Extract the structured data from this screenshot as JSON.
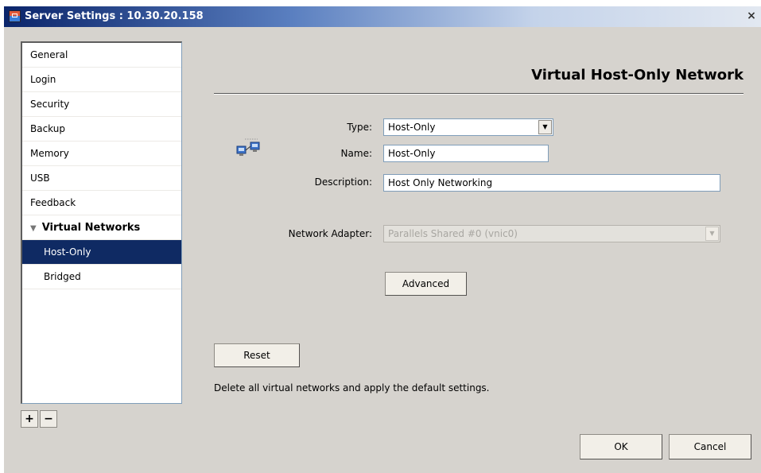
{
  "window": {
    "title": "Server Settings : 10.30.20.158",
    "close_glyph": "×"
  },
  "sidebar": {
    "items": [
      {
        "label": "General"
      },
      {
        "label": "Login"
      },
      {
        "label": "Security"
      },
      {
        "label": "Backup"
      },
      {
        "label": "Memory"
      },
      {
        "label": "USB"
      },
      {
        "label": "Feedback"
      },
      {
        "label": "Virtual Networks",
        "expanded": true
      },
      {
        "label": "Host-Only",
        "selected": true
      },
      {
        "label": "Bridged"
      }
    ],
    "add_label": "+",
    "remove_label": "−",
    "expand_glyph": "▼"
  },
  "main": {
    "heading": "Virtual Host-Only Network",
    "network_icon": "network-adapter-icon",
    "form": {
      "type_label": "Type:",
      "type_value": "Host-Only",
      "name_label": "Name:",
      "name_value": "Host-Only",
      "description_label": "Description:",
      "description_value": "Host Only Networking",
      "adapter_label": "Network Adapter:",
      "adapter_value": "Parallels Shared #0 (vnic0)",
      "dropdown_glyph": "▼"
    },
    "advanced_label": "Advanced",
    "reset_label": "Reset",
    "reset_note": "Delete all virtual networks and apply the default settings."
  },
  "footer": {
    "ok_label": "OK",
    "cancel_label": "Cancel"
  }
}
